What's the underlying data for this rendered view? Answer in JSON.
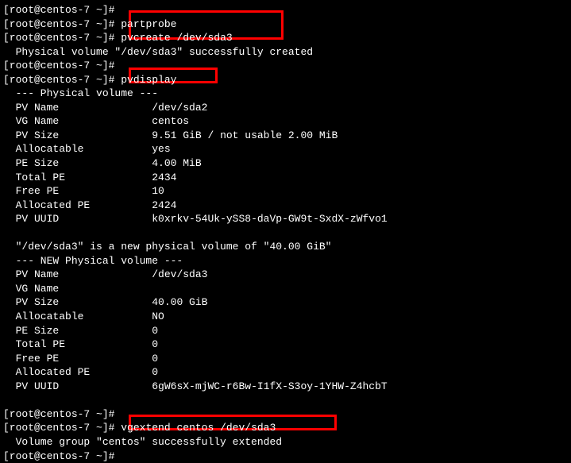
{
  "prompt": "[root@centos-7 ~]#",
  "cmd1": "partprobe",
  "cmd2": "pvcreate /dev/sda3",
  "out_pvcreate": "  Physical volume \"/dev/sda3\" successfully created",
  "cmd3": "pvdisplay",
  "pvdisplay": {
    "header1": "  --- Physical volume ---",
    "pv1": {
      "name_label": "  PV Name",
      "name_val": "/dev/sda2",
      "vgname_label": "  VG Name",
      "vgname_val": "centos",
      "pvsize_label": "  PV Size",
      "pvsize_val": "9.51 GiB / not usable 2.00 MiB",
      "alloc_label": "  Allocatable",
      "alloc_val": "yes",
      "pesize_label": "  PE Size",
      "pesize_val": "4.00 MiB",
      "totalpe_label": "  Total PE",
      "totalpe_val": "2434",
      "freepe_label": "  Free PE",
      "freepe_val": "10",
      "allocpe_label": "  Allocated PE",
      "allocpe_val": "2424",
      "uuid_label": "  PV UUID",
      "uuid_val": "k0xrkv-54Uk-ySS8-daVp-GW9t-SxdX-zWfvo1"
    },
    "newpv_line": "  \"/dev/sda3\" is a new physical volume of \"40.00 GiB\"",
    "header2": "  --- NEW Physical volume ---",
    "pv2": {
      "name_label": "  PV Name",
      "name_val": "/dev/sda3",
      "vgname_label": "  VG Name",
      "vgname_val": "",
      "pvsize_label": "  PV Size",
      "pvsize_val": "40.00 GiB",
      "alloc_label": "  Allocatable",
      "alloc_val": "NO",
      "pesize_label": "  PE Size",
      "pesize_val": "0",
      "totalpe_label": "  Total PE",
      "totalpe_val": "0",
      "freepe_label": "  Free PE",
      "freepe_val": "0",
      "allocpe_label": "  Allocated PE",
      "allocpe_val": "0",
      "uuid_label": "  PV UUID",
      "uuid_val": "6gW6sX-mjWC-r6Bw-I1fX-S3oy-1YHW-Z4hcbT"
    }
  },
  "cmd4": "vgextend centos /dev/sda3",
  "out_vgextend": "  Volume group \"centos\" successfully extended",
  "pad_label": "               ",
  "pad_val_short": "        "
}
